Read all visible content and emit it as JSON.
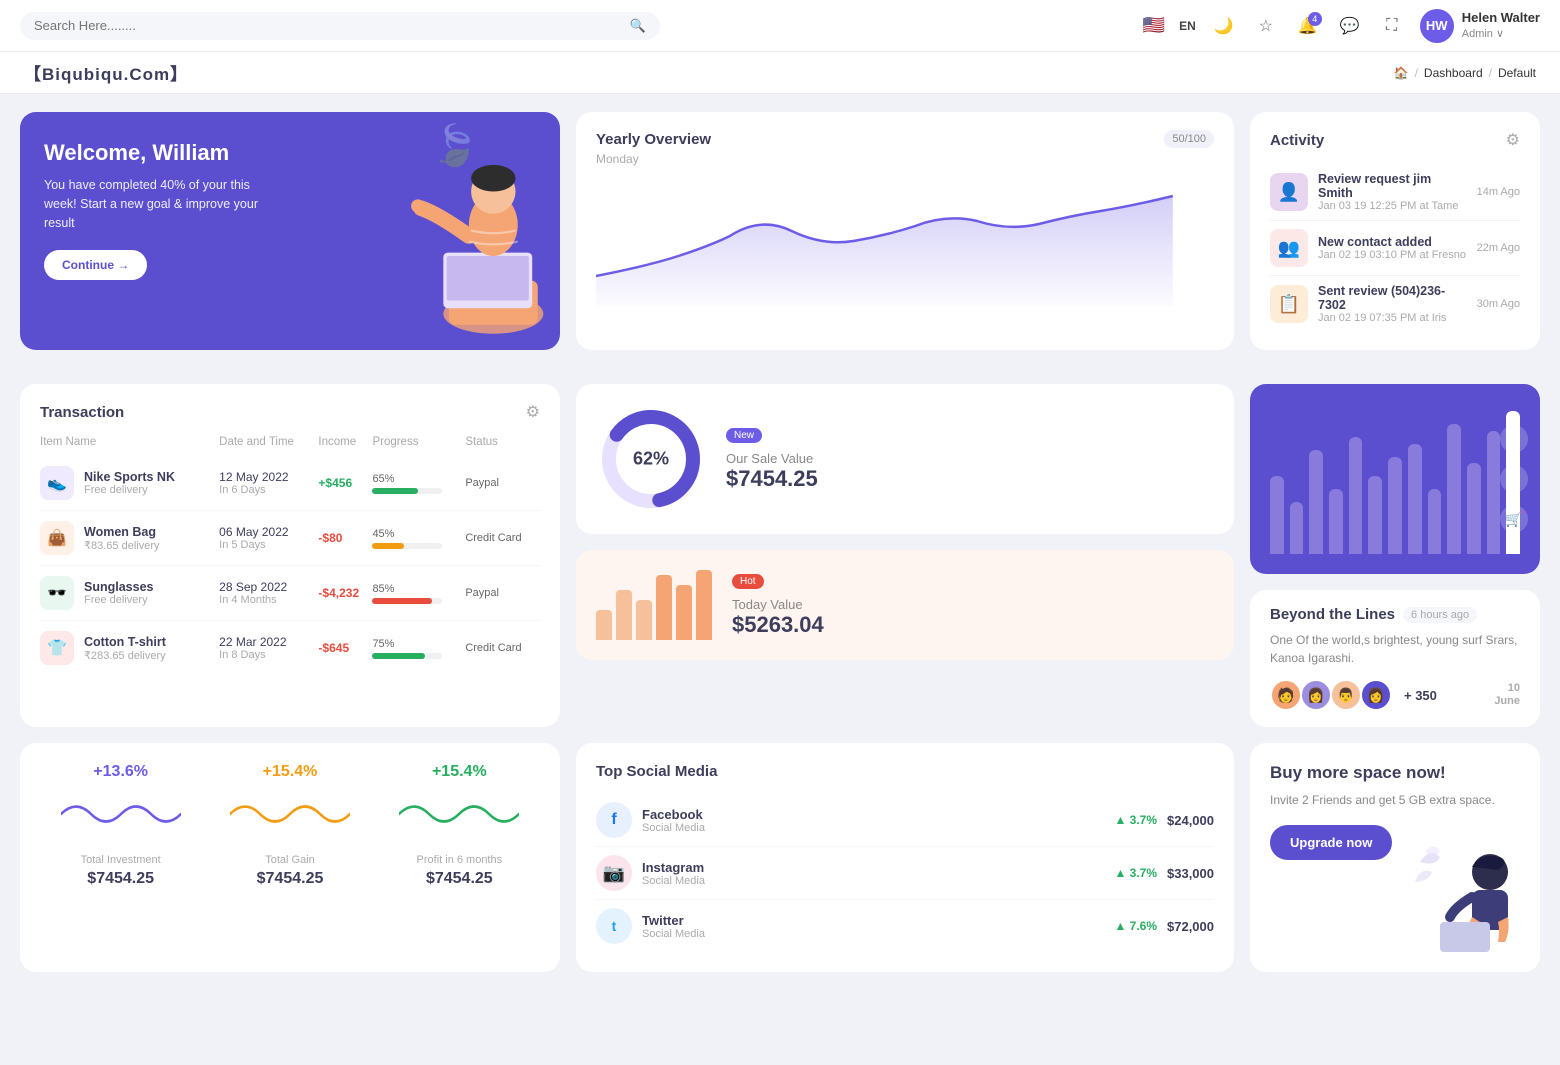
{
  "topnav": {
    "search_placeholder": "Search Here........",
    "lang": "EN",
    "user": {
      "name": "Helen Walter",
      "role": "Admin",
      "initials": "HW"
    },
    "notification_count": "4"
  },
  "breadcrumb": {
    "brand": "【Biqubiqu.Com】",
    "home": "🏠",
    "dashboard": "Dashboard",
    "current": "Default"
  },
  "welcome": {
    "title": "Welcome, William",
    "desc": "You have completed 40% of your this week! Start a new goal & improve your result",
    "btn": "Continue →"
  },
  "yearly": {
    "title": "Yearly Overview",
    "sub": "Monday",
    "badge": "50/100"
  },
  "activity": {
    "title": "Activity",
    "items": [
      {
        "title": "Review request jim Smith",
        "sub": "Jan 03 19 12:25 PM at Tame",
        "time": "14m Ago",
        "color": "#e8d5f0"
      },
      {
        "title": "New contact added",
        "sub": "Jan 02 19 03:10 PM at Fresno",
        "time": "22m Ago",
        "color": "#fde8e8"
      },
      {
        "title": "Sent review (504)236-7302",
        "sub": "Jan 02 19 07:35 PM at Iris",
        "time": "30m Ago",
        "color": "#fdecd8"
      }
    ]
  },
  "transaction": {
    "title": "Transaction",
    "headers": [
      "Item Name",
      "Date and Time",
      "Income",
      "Progress",
      "Status"
    ],
    "rows": [
      {
        "icon": "👟",
        "icon_bg": "#f0eaff",
        "name": "Nike Sports NK",
        "sub": "Free delivery",
        "date": "12 May 2022",
        "days": "In 6 Days",
        "income": "+$456",
        "income_type": "pos",
        "progress": 65,
        "progress_color": "#27ae60",
        "status": "Paypal"
      },
      {
        "icon": "👜",
        "icon_bg": "#fff0e8",
        "name": "Women Bag",
        "sub": "₹83.65 delivery",
        "date": "06 May 2022",
        "days": "In 5 Days",
        "income": "-$80",
        "income_type": "neg",
        "progress": 45,
        "progress_color": "#f39c12",
        "status": "Credit Card"
      },
      {
        "icon": "🕶️",
        "icon_bg": "#e8f8f0",
        "name": "Sunglasses",
        "sub": "Free delivery",
        "date": "28 Sep 2022",
        "days": "In 4 Months",
        "income": "-$4,232",
        "income_type": "neg",
        "progress": 85,
        "progress_color": "#e74c3c",
        "status": "Paypal"
      },
      {
        "icon": "👕",
        "icon_bg": "#ffe8e8",
        "name": "Cotton T-shirt",
        "sub": "₹283.65 delivery",
        "date": "22 Mar 2022",
        "days": "In 8 Days",
        "income": "-$645",
        "income_type": "neg",
        "progress": 75,
        "progress_color": "#27ae60",
        "status": "Credit Card"
      }
    ]
  },
  "sale": {
    "badge": "New",
    "label": "Our Sale Value",
    "value": "$7454.25",
    "percent": 62,
    "percent_label": "62%"
  },
  "today": {
    "badge": "Hot",
    "label": "Today Value",
    "value": "$5263.04",
    "bars": [
      30,
      50,
      40,
      65,
      55,
      70
    ]
  },
  "barchart": {
    "bars": [
      60,
      40,
      80,
      50,
      90,
      60,
      75,
      85,
      50,
      100,
      70,
      95,
      110
    ],
    "active_index": 12
  },
  "beyond": {
    "title": "Beyond the Lines",
    "time": "6 hours ago",
    "desc": "One Of the world,s brightest, young surf Srars, Kanoa Igarashi.",
    "plus_count": "+ 350",
    "date": "10",
    "month": "June",
    "avatars": [
      "🧑",
      "👩",
      "👨",
      "👩"
    ]
  },
  "stats": [
    {
      "pct": "+13.6%",
      "label": "Total Investment",
      "value": "$7454.25",
      "color": "#6c5ce7"
    },
    {
      "pct": "+15.4%",
      "label": "Total Gain",
      "value": "$7454.25",
      "color": "#f39c12"
    },
    {
      "pct": "+15.4%",
      "label": "Profit in 6 months",
      "value": "$7454.25",
      "color": "#27ae60"
    }
  ],
  "social": {
    "title": "Top Social Media",
    "items": [
      {
        "name": "Facebook",
        "sub": "Social Media",
        "pct": "3.7%",
        "value": "$24,000",
        "color": "#1877f2",
        "icon": "f"
      },
      {
        "name": "Instagram",
        "sub": "Social Media",
        "pct": "3.7%",
        "value": "$33,000",
        "color": "#e1306c",
        "icon": "📷"
      },
      {
        "name": "Twitter",
        "sub": "Social Media",
        "pct": "7.6%",
        "value": "$72,000",
        "color": "#1da1f2",
        "icon": "t"
      }
    ]
  },
  "upgrade": {
    "title": "Buy more space now!",
    "desc": "Invite 2 Friends and get 5 GB extra space.",
    "btn": "Upgrade now"
  }
}
